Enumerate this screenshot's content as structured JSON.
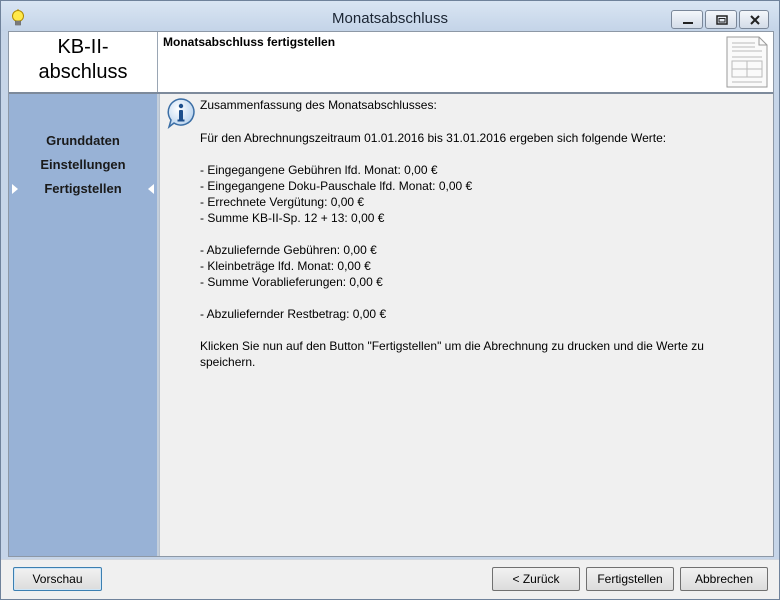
{
  "window": {
    "title": "Monatsabschluss",
    "app_icon": "lightbulb-icon"
  },
  "header": {
    "logo": "KB-II-\nabschluss",
    "heading": "Monatsabschluss fertigstellen",
    "doc_icon": "document-icon"
  },
  "sidebar": {
    "items": [
      {
        "label": "Grunddaten",
        "active": false
      },
      {
        "label": "Einstellungen",
        "active": false
      },
      {
        "label": "Fertigstellen",
        "active": true
      }
    ]
  },
  "content": {
    "info_icon": "info-icon",
    "title": "Zusammenfassung des Monatsabschlusses:",
    "intro": "Für den Abrechnungszeitraum 01.01.2016 bis 31.01.2016 ergeben sich folgende Werte:",
    "group1": [
      "- Eingegangene Gebühren lfd. Monat: 0,00 €",
      "- Eingegangene Doku-Pauschale lfd. Monat: 0,00 €",
      "- Errechnete Vergütung: 0,00 €",
      "- Summe KB-II-Sp. 12 + 13: 0,00 €"
    ],
    "group2": [
      "- Abzuliefernde Gebühren: 0,00 €",
      "- Kleinbeträge lfd. Monat: 0,00 €",
      "- Summe Vorablieferungen: 0,00 €"
    ],
    "group3": [
      "- Abzuliefernder Restbetrag: 0,00 €"
    ],
    "outro_line1": "Klicken Sie nun auf den Button \"Fertigstellen\" um die Abrechnung zu drucken und die Werte zu",
    "outro_line2": "speichern."
  },
  "footer": {
    "preview_label": "Vorschau",
    "back_label": "< Zurück",
    "finish_label": "Fertigstellen",
    "cancel_label": "Abbrechen"
  },
  "colors": {
    "sidebar": "#98b2d6",
    "window_frame": "#c6d5e8",
    "content_bg": "#f0f0f0",
    "focus_border": "#3c7fb1"
  }
}
